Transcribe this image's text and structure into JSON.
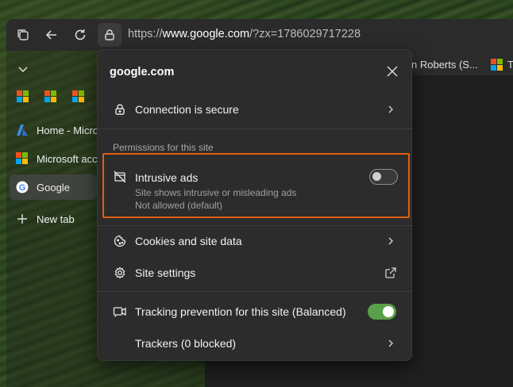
{
  "browser": {
    "address_prefix": "https://",
    "address_domain": "www.google.com",
    "address_path": "/?zx=1786029717228"
  },
  "favorites_bar": {
    "items": [
      {
        "label": "n Roberts (S...",
        "icon": "partial-icon"
      },
      {
        "label": "Ta",
        "icon": "microsoft-logo-icon"
      }
    ]
  },
  "sidebar": {
    "tabs": [
      {
        "label": "Home - Micros",
        "icon": "azure-icon"
      },
      {
        "label": "Microsoft acco",
        "icon": "microsoft-logo-icon"
      },
      {
        "label": "Google",
        "icon": "google-icon",
        "active": true
      }
    ],
    "new_tab_label": "New tab"
  },
  "site_info_popup": {
    "title": "google.com",
    "connection_label": "Connection is secure",
    "permissions_header": "Permissions for this site",
    "intrusive_ads": {
      "title": "Intrusive ads",
      "description": "Site shows intrusive or misleading ads",
      "status": "Not allowed (default)",
      "enabled": false
    },
    "cookies_label": "Cookies and site data",
    "site_settings_label": "Site settings",
    "tracking": {
      "label": "Tracking prevention for this site (Balanced)",
      "enabled": true
    },
    "trackers_label": "Trackers (0 blocked)"
  },
  "colors": {
    "highlight_border": "#e0600f",
    "toggle_on": "#5aa04a",
    "popup_bg": "#2c2c2c"
  }
}
